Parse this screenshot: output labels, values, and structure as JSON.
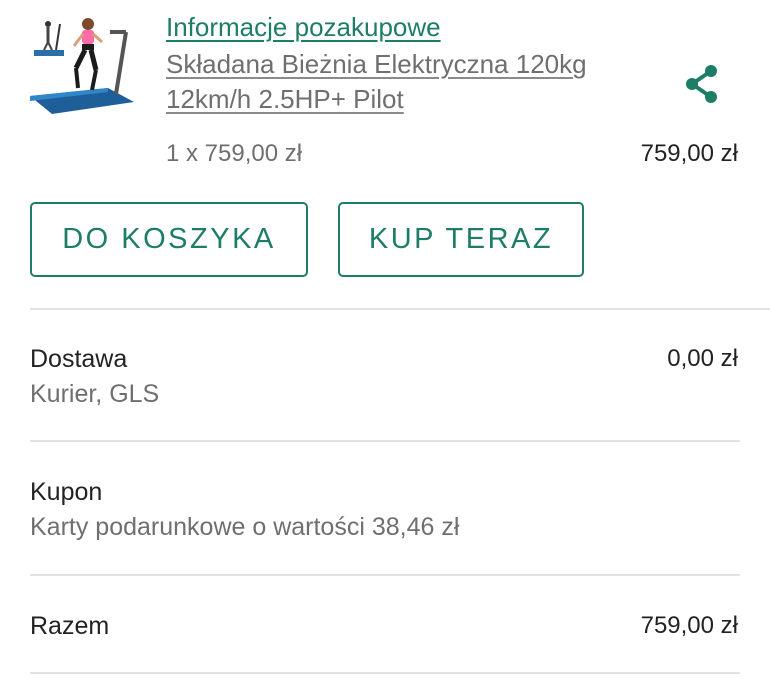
{
  "product": {
    "link_label": "Informacje pozakupowe",
    "name": "Składana Bieżnia Elektryczna 120kg 12km/h 2.5HP+ Pilot",
    "quantity_price": "1 x 759,00 zł",
    "line_total": "759,00 zł",
    "image_icon": "treadmill-product-photo"
  },
  "actions": {
    "add_to_cart": "DO KOSZYKA",
    "buy_now": "KUP TERAZ",
    "share_icon": "share-icon"
  },
  "summary": {
    "delivery": {
      "title": "Dostawa",
      "detail": "Kurier, GLS",
      "amount": "0,00 zł"
    },
    "coupon": {
      "title": "Kupon",
      "detail": "Karty podarunkowe o wartości 38,46 zł"
    },
    "total": {
      "title": "Razem",
      "amount": "759,00 zł"
    }
  },
  "colors": {
    "accent": "#1d7d66",
    "muted_text": "#6f6f6f",
    "divider": "#e2e2e2"
  }
}
